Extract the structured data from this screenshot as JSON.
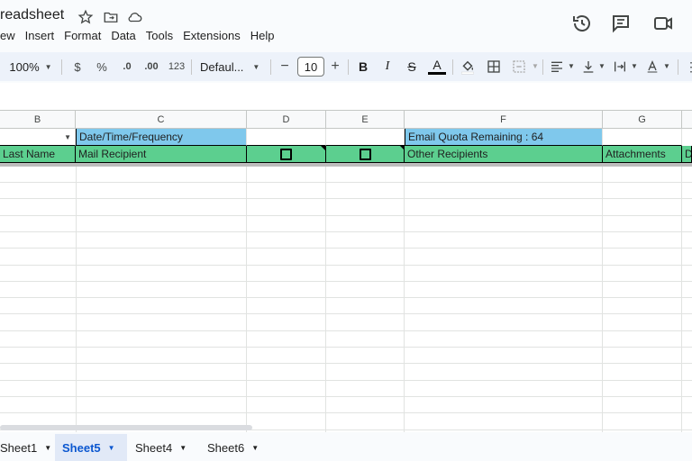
{
  "app": {
    "doc_title": "readsheet",
    "menu": [
      "ew",
      "Insert",
      "Format",
      "Data",
      "Tools",
      "Extensions",
      "Help"
    ]
  },
  "toolbar": {
    "zoom": "100%",
    "currency": "$",
    "percent": "%",
    "decrease_decimal": ".0",
    "increase_decimal": ".00",
    "number_format": "123",
    "font": "Defaul...",
    "font_size": "10",
    "minus": "−",
    "plus": "+",
    "bold": "B",
    "italic": "I",
    "strike": "S",
    "text_color": "A",
    "text_color_value": "#000000"
  },
  "columns": [
    "B",
    "C",
    "D",
    "E",
    "F",
    "G"
  ],
  "rows": {
    "row1": {
      "c": "Date/Time/Frequency",
      "f": "Email Quota Remaining : 64"
    },
    "row2": {
      "b": "Last Name",
      "c": "Mail Recipient",
      "f": "Other Recipients",
      "g": "Attachments",
      "h": "D"
    }
  },
  "sheet_tabs": [
    {
      "label": "Sheet1",
      "active": false
    },
    {
      "label": "Sheet5",
      "active": true
    },
    {
      "label": "Sheet4",
      "active": false
    },
    {
      "label": "Sheet6",
      "active": false
    }
  ],
  "colors": {
    "header_blue": "#7fc8ec",
    "header_green": "#5ccf8f",
    "active_tab_text": "#0b57d0",
    "toolbar_bg": "#edf2fa"
  }
}
